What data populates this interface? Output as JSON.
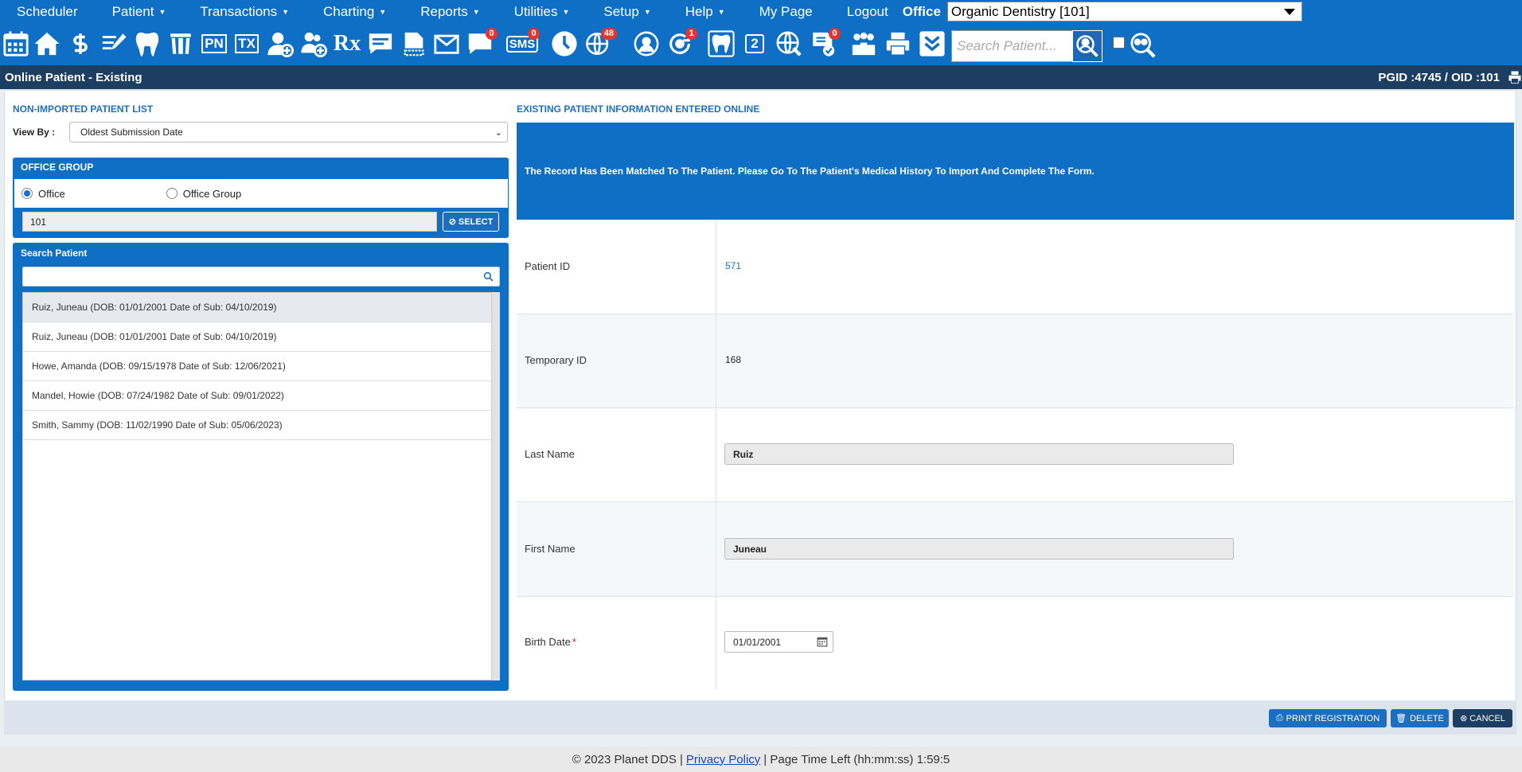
{
  "menu": {
    "items": [
      {
        "label": "Scheduler",
        "caret": false
      },
      {
        "label": "Patient",
        "caret": true
      },
      {
        "label": "Transactions",
        "caret": true
      },
      {
        "label": "Charting",
        "caret": true
      },
      {
        "label": "Reports",
        "caret": true
      },
      {
        "label": "Utilities",
        "caret": true
      },
      {
        "label": "Setup",
        "caret": true
      },
      {
        "label": "Help",
        "caret": true
      },
      {
        "label": "My Page",
        "caret": false
      },
      {
        "label": "Logout",
        "caret": false
      }
    ],
    "office_label": "Office",
    "office_value": "Organic Dentistry [101]"
  },
  "toolbar": {
    "badges": {
      "chat": "0",
      "sms_text": "SMS",
      "sms": "0",
      "globe": "48",
      "sync": "1",
      "form": "0"
    },
    "pn": "PN",
    "tx": "TX",
    "rx": "Rx",
    "two": "2",
    "search_placeholder": "Search Patient..."
  },
  "title_bar": {
    "title": "Online Patient - Existing",
    "ids": "PGID :4745  /  OID :101"
  },
  "left": {
    "section_title": "NON-IMPORTED PATIENT LIST",
    "view_by_label": "View By :",
    "view_by_value": "Oldest Submission Date",
    "office_group_title": "OFFICE GROUP",
    "radio_office": "Office",
    "radio_office_group": "Office Group",
    "office_value": "101",
    "select_button": "SELECT",
    "search_title": "Search Patient",
    "patients": [
      "Ruiz, Juneau (DOB: 01/01/2001 Date of Sub: 04/10/2019)",
      "Ruiz, Juneau (DOB: 01/01/2001 Date of Sub: 04/10/2019)",
      "Howe, Amanda (DOB: 09/15/1978 Date of Sub: 12/06/2021)",
      "Mandel, Howie (DOB: 07/24/1982 Date of Sub: 09/01/2022)",
      "Smith, Sammy (DOB: 11/02/1990 Date of Sub: 05/06/2023)"
    ]
  },
  "right": {
    "section_title": "EXISTING PATIENT INFORMATION ENTERED ONLINE",
    "banner": "The Record Has Been Matched To The Patient. Please Go To The Patient's Medical History To Import And Complete The Form.",
    "patient_id_label": "Patient ID",
    "patient_id_value": "571",
    "temp_id_label": "Temporary ID",
    "temp_id_value": "168",
    "last_name_label": "Last Name",
    "last_name_value": "Ruiz",
    "first_name_label": "First Name",
    "first_name_value": "Juneau",
    "birth_date_label": "Birth Date",
    "required_mark": "*",
    "birth_date_value": "01/01/2001"
  },
  "buttons": {
    "print": "PRINT REGISTRATION",
    "delete": "DELETE",
    "cancel": "CANCEL"
  },
  "footer": {
    "copyright": "© 2023 Planet DDS |",
    "privacy": "Privacy Policy",
    "time_left": "|  Page Time Left (hh:mm:ss) 1:59:5"
  },
  "colors": {
    "primary": "#0e6fc4",
    "title_bar": "#1d3e63",
    "badge": "#e8322d"
  }
}
